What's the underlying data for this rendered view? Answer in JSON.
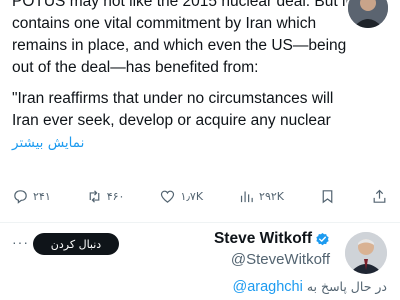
{
  "tweet": {
    "paragraph1": "POTUS may not like the 2015 nuclear deal. But it contains one vital commitment by Iran which remains in place, and which even the US—being out of the deal—has benefited from:",
    "paragraph2": "\"Iran reaffirms that under no circumstances will Iran ever seek, develop or acquire any nuclear",
    "show_more": "نمایش بیشتر"
  },
  "actions": {
    "replies": "۲۴۱",
    "reposts": "۴۶۰",
    "likes": "۱٫۷K",
    "views": "۲۹۲K"
  },
  "reply": {
    "follow_label": "دنبال کردن",
    "author_name": "Steve Witkoff",
    "author_handle": "@SteveWitkoff",
    "replying_label": "در حال پاسخ به",
    "replying_to": "@araghchi"
  },
  "colors": {
    "accent": "#1d9bf0",
    "text": "#0f1419",
    "muted": "#536471",
    "button": "#0f1419"
  }
}
